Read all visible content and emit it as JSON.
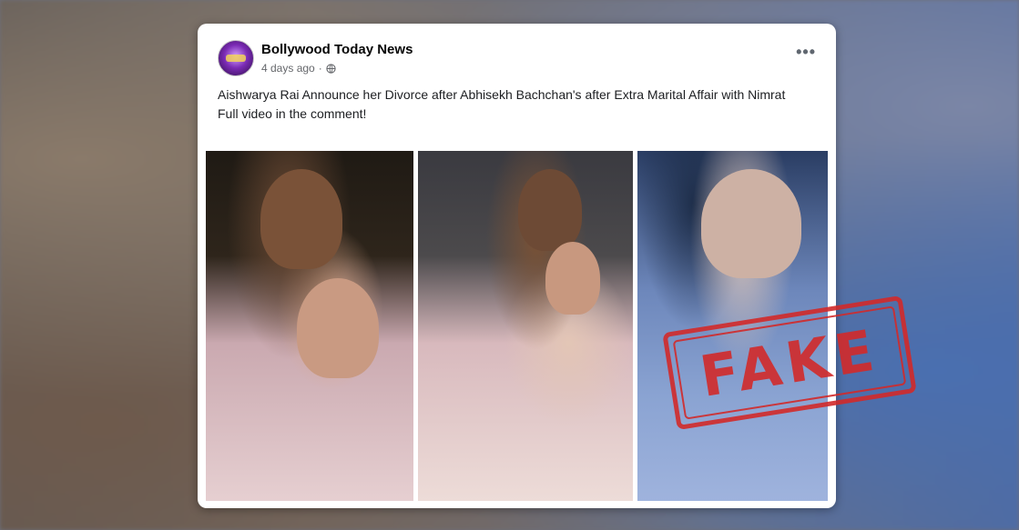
{
  "post": {
    "page_name": "Bollywood Today News",
    "time": "4 days ago",
    "separator": "·",
    "more_label": "•••",
    "text_line1": "Aishwarya Rai Announce her Divorce after Abhisekh Bachchan's after Extra Marital Affair with Nimrat",
    "text_line2": "Full video in the comment!"
  },
  "stamp": {
    "label": "FAKE",
    "color": "#d22a2a"
  },
  "icons": {
    "privacy": "globe-icon",
    "menu": "more-options-icon"
  }
}
